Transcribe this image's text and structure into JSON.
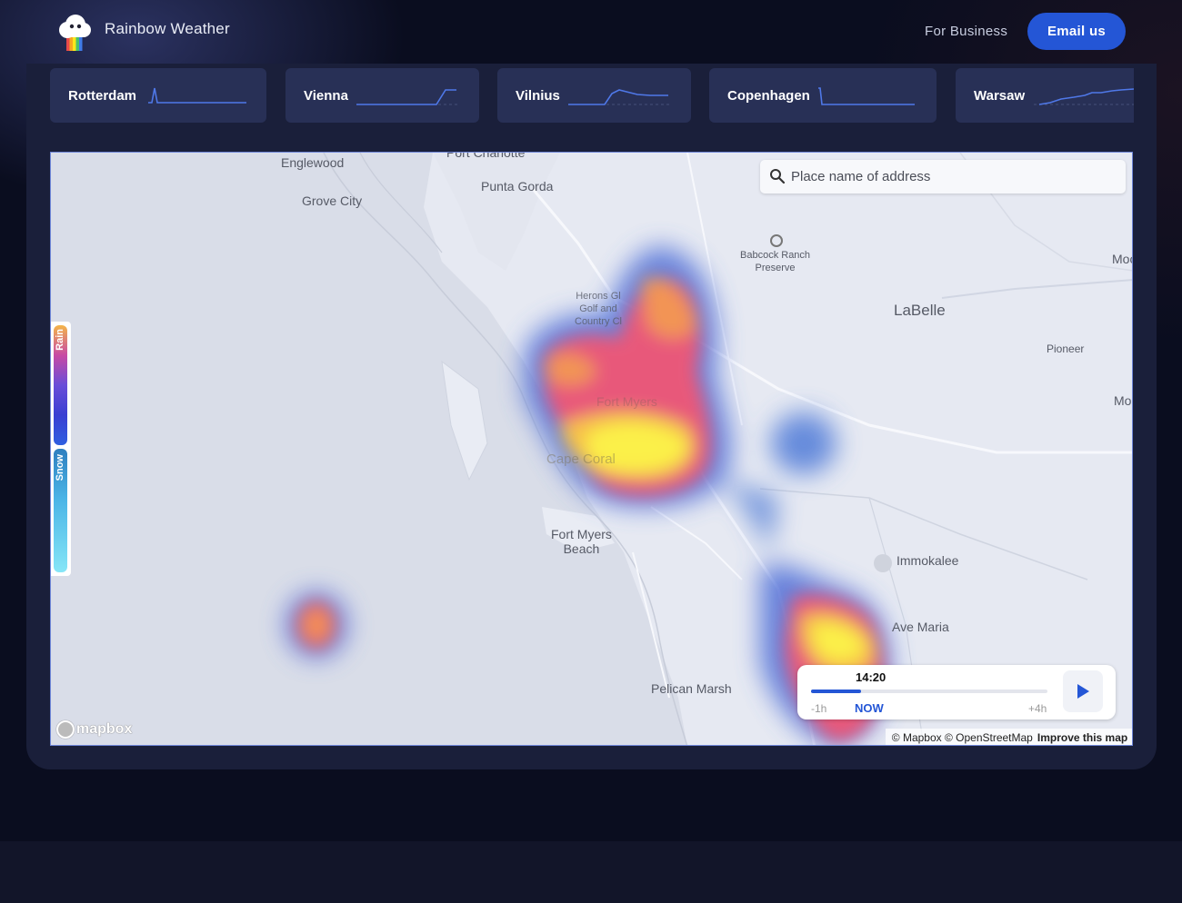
{
  "header": {
    "app_title": "Rainbow Weather",
    "nav_business": "For Business",
    "email_button": "Email us"
  },
  "cities": [
    {
      "name": "Rotterdam"
    },
    {
      "name": "Vienna"
    },
    {
      "name": "Vilnius"
    },
    {
      "name": "Copenhagen"
    },
    {
      "name": "Warsaw"
    }
  ],
  "map": {
    "search_placeholder": "Place name of address",
    "legend_rain": "Rain",
    "legend_snow": "Snow",
    "labels": {
      "port_charlotte": "Port Charlotte",
      "englewood": "Englewood",
      "grove_city": "Grove City",
      "punta_gorda": "Punta Gorda",
      "babcock": "Babcock Ranch\nPreserve",
      "herons": "Herons Gl\nGolf and\nCountry Cl",
      "labelle": "LaBelle",
      "pioneer": "Pioneer",
      "moo": "Moo",
      "mor": "Mor",
      "fort_myers": "Fort Myers",
      "cape_coral": "Cape Coral",
      "fort_myers_beach": "Fort Myers\nBeach",
      "immokalee": "Immokalee",
      "ave_maria": "Ave Maria",
      "pelican_marsh": "Pelican Marsh"
    },
    "mapbox_logo": "mapbox",
    "attribution": "© Mapbox © OpenStreetMap",
    "improve_link": "Improve this map"
  },
  "timeline": {
    "current_time": "14:20",
    "start_label": "-1h",
    "now_label": "NOW",
    "end_label": "+4h",
    "progress": 0.21
  },
  "colors": {
    "accent": "#2456d6",
    "background": "#0a0d1f",
    "panel": "#1a1f3a",
    "card": "#283056",
    "sparkline": "#4f78e8"
  }
}
